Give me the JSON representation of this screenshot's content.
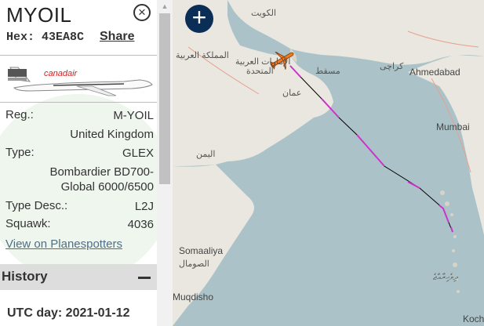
{
  "aircraft": {
    "callsign": "MYOIL",
    "hex_label": "Hex: 43EA8C",
    "share_label": "Share",
    "close_icon": "close-icon",
    "photo_brand": "canadair"
  },
  "details": [
    {
      "label": "Reg.:",
      "value": "M-YOIL"
    },
    {
      "label": "",
      "value": "United Kingdom"
    },
    {
      "label": "Type:",
      "value": "GLEX"
    },
    {
      "label": "",
      "value": "Bombardier BD700-Global 6000/6500"
    },
    {
      "label": "Type Desc.:",
      "value": "L2J"
    },
    {
      "label": "Squawk:",
      "value": "4036"
    }
  ],
  "planespotters_link": "View on Planespotters",
  "history": {
    "title": "History",
    "collapse_icon": "minus-icon",
    "utc_day": "UTC day: 2021-01-12"
  },
  "map": {
    "zoom_icon": "plus-icon",
    "labels": [
      "الكويت",
      "المملكة العربية",
      "الإمارات العربية",
      "المتحدة",
      "مسقط",
      "عمان",
      "كراچی",
      "Ahmedabad",
      "Mumbai",
      "اليمن",
      "Somaaliya",
      "الصومال",
      "Muqdisho",
      "ދިވެހިރާއްޖެ",
      "Kochi"
    ]
  },
  "colors": {
    "accent_dark": "#0b2e56",
    "track": "#000000",
    "track_highlight": "#cc33cc",
    "plane": "#f47a20",
    "water": "#abc3c8",
    "land": "#e9e7df",
    "history_bar": "#dddddd"
  }
}
